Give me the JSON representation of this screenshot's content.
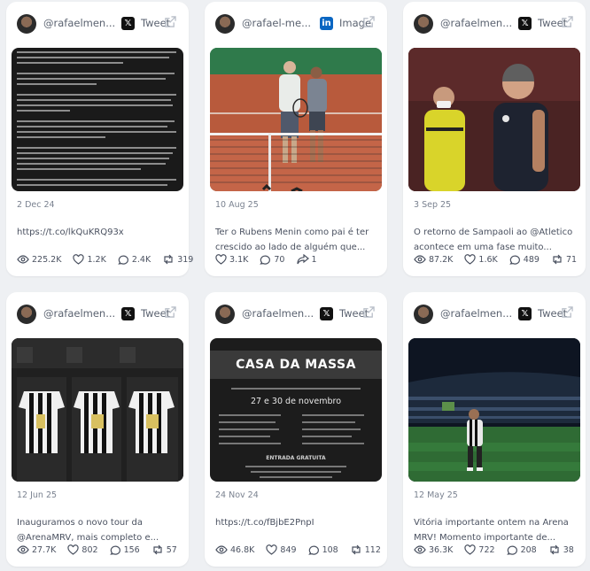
{
  "cards": [
    {
      "handle": "@rafaelmen...",
      "platform_icon": "x-logo",
      "platform_label": "Tweet",
      "date": "2 Dec 24",
      "text": "https://t.co/lkQuKRQ93x",
      "stats": {
        "views": "225.2K",
        "likes": "1.2K",
        "replies": "2.4K",
        "reposts": "319"
      }
    },
    {
      "handle": "@rafael-me...",
      "platform_icon": "linkedin-logo",
      "platform_label": "Image",
      "date": "10 Aug 25",
      "text_lines": [
        "Ter o Rubens Menin como pai é ter",
        "crescido ao lado de alguém que..."
      ],
      "stats": {
        "likes": "3.1K",
        "replies": "70",
        "shares": "1"
      }
    },
    {
      "handle": "@rafaelmen...",
      "platform_icon": "x-logo",
      "platform_label": "Tweet",
      "date": "3 Sep 25",
      "text_lines": [
        "O retorno de Sampaoli ao @Atletico",
        "acontece em uma fase muito..."
      ],
      "stats": {
        "views": "87.2K",
        "likes": "1.6K",
        "replies": "489",
        "reposts": "71"
      }
    },
    {
      "handle": "@rafaelmen...",
      "platform_icon": "x-logo",
      "platform_label": "Tweet",
      "date": "12 Jun 25",
      "text_lines": [
        "Inauguramos o novo tour da",
        "@ArenaMRV, mais completo e..."
      ],
      "stats": {
        "views": "27.7K",
        "likes": "802",
        "replies": "156",
        "reposts": "57"
      }
    },
    {
      "handle": "@rafaelmen...",
      "platform_icon": "x-logo",
      "platform_label": "Tweet",
      "date": "24 Nov 24",
      "text": "https://t.co/fBjbE2PnpI",
      "media_title": "CASA DA MASSA",
      "media_dates": "27 e 30 de novembro",
      "media_entry": "ENTRADA GRATUITA",
      "stats": {
        "views": "46.8K",
        "likes": "849",
        "replies": "108",
        "reposts": "112"
      }
    },
    {
      "handle": "@rafaelmen...",
      "platform_icon": "x-logo",
      "platform_label": "Tweet",
      "date": "12 May 25",
      "text_lines": [
        "Vitória importante ontem na Arena",
        "MRV! Momento importante de..."
      ],
      "stats": {
        "views": "36.3K",
        "likes": "722",
        "replies": "208",
        "reposts": "38"
      }
    }
  ]
}
